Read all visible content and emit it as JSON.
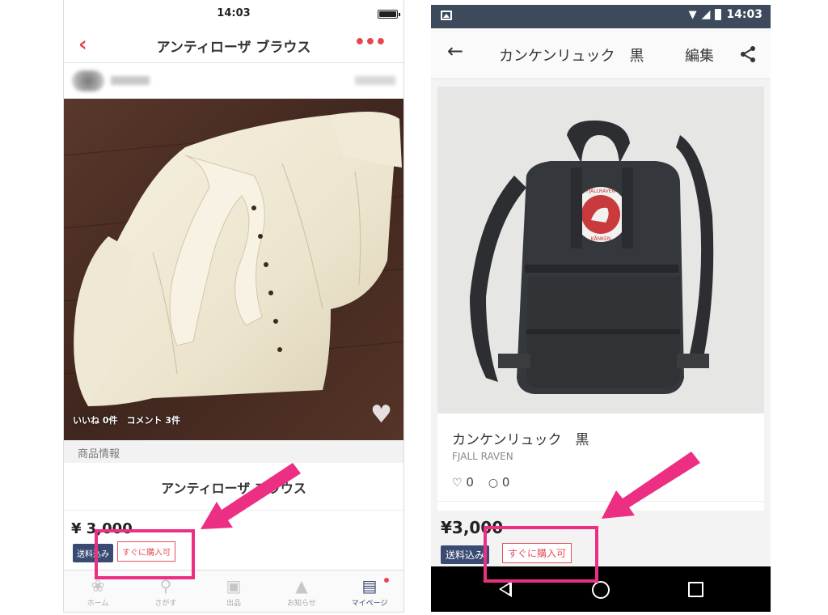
{
  "left_app": {
    "status_time": "14:03",
    "nav": {
      "back_icon": "chevron-left-icon",
      "title": "アンティローザ ブラウス",
      "more_icon": "more-dots-icon"
    },
    "photo_overlay": "いいね 0件　コメント 3件",
    "section_header": "商品情報",
    "item_title": "アンティローザ ブラウス",
    "price": "¥ 3,000",
    "tag_shipping": "送料込み",
    "tag_buy": "すぐに購入可",
    "tabbar": [
      {
        "label": "ホーム",
        "icon": "home-icon"
      },
      {
        "label": "さがす",
        "icon": "search-icon"
      },
      {
        "label": "出品",
        "icon": "camera-icon"
      },
      {
        "label": "お知らせ",
        "icon": "bell-icon"
      },
      {
        "label": "マイページ",
        "icon": "profile-card-icon"
      }
    ]
  },
  "right_app": {
    "status_time": "14:03",
    "toolbar": {
      "back_icon": "arrow-left-icon",
      "title": "カンケンリュック　黒",
      "edit_label": "編集",
      "share_icon": "share-icon"
    },
    "item_title": "カンケンリュック　黒",
    "brand": "FJALL RAVEN",
    "likes": "0",
    "comments": "0",
    "price": "¥3,000",
    "tag_shipping": "送料込み",
    "tag_buy": "すぐに購入可",
    "logo_text": {
      "top": "FJÄLLRAVEN",
      "bottom": "KÅNKEN"
    }
  },
  "colors": {
    "accent": "#e5474f",
    "annotation": "#ec2f82",
    "tag_navy": "#3a4b73",
    "android_status": "#3c4a5c"
  }
}
